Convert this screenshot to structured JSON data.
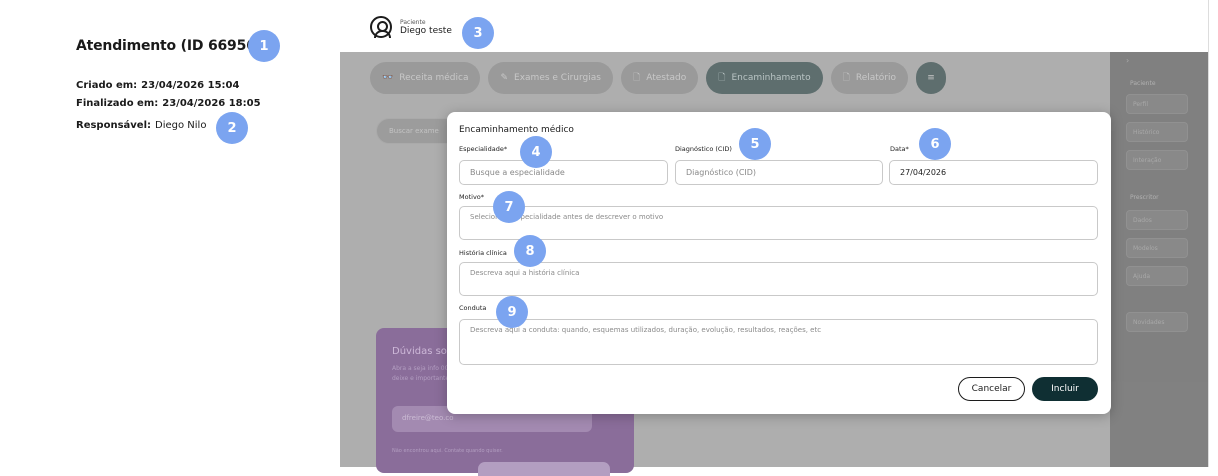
{
  "attendance": {
    "title": "Atendimento (ID 66956)",
    "created_label": "Criado em:",
    "created_value": "23/04/2026 15:04",
    "finished_label": "Finalizado em:",
    "finished_value": "23/04/2026 18:05",
    "responsible_label": "Responsável:",
    "responsible_value": "Diego Nilo"
  },
  "patient": {
    "label": "Paciente",
    "name": "Diego teste",
    "icon": "user-circle-icon"
  },
  "tabs": [
    {
      "label": "Receita médica",
      "icon": "glasses-icon"
    },
    {
      "label": "Exames e Cirurgias",
      "icon": "pen-icon"
    },
    {
      "label": "Atestado",
      "icon": "document-plus-icon"
    },
    {
      "label": "Encaminhamento",
      "icon": "document-icon",
      "active": true
    },
    {
      "label": "Relatório",
      "icon": "file-icon"
    },
    {
      "label": "≡",
      "icon": "menu-icon"
    }
  ],
  "background": {
    "search_placeholder": "Buscar exame",
    "promo_title": "Dúvidas so",
    "promo_text": "Abra a seja info 000000, deixe e importantes",
    "promo_input": "dfreire@teo.co",
    "promo_footer": "Não encontrou aqui. Contate quando quiser."
  },
  "right_sidebar": {
    "chevron": "›",
    "section_patient": "Paciente",
    "items_patient": [
      "Perfil",
      "Histórico",
      "Interação"
    ],
    "section_prescriber": "Prescritor",
    "items_prescriber": [
      "Dados",
      "Modelos",
      "Ajuda"
    ],
    "news": "Novidades"
  },
  "modal": {
    "title": "Encaminhamento médico",
    "specialty_label": "Especialidade*",
    "specialty_placeholder": "Busque a especialidade",
    "cid_label": "Diagnóstico (CID)",
    "cid_placeholder": "Diagnóstico (CID)",
    "date_label": "Data*",
    "date_value": "27/04/2026",
    "reason_label": "Motivo*",
    "reason_placeholder": "Selecione a especialidade antes de descrever o motivo",
    "history_label": "História clínica",
    "history_placeholder": "Descreva aqui a história clínica",
    "conduct_label": "Conduta",
    "conduct_placeholder": "Descreva aqui a conduta: quando, esquemas utilizados, duração, evolução, resultados, reações, etc",
    "cancel_label": "Cancelar",
    "include_label": "Incluir"
  },
  "badges": [
    "1",
    "2",
    "3",
    "4",
    "5",
    "6",
    "7",
    "8",
    "9"
  ],
  "colors": {
    "badge": "#7ba4f0",
    "primary_button": "#0f2f33",
    "overlay": "#7a7a7a"
  }
}
